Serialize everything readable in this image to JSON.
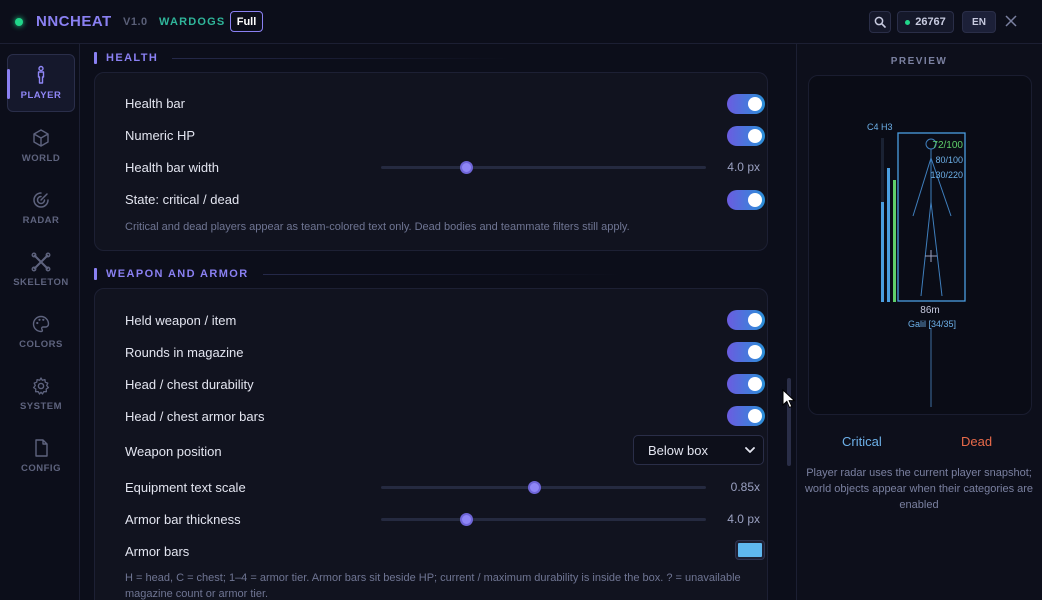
{
  "header": {
    "brand": "NNCHEAT",
    "version": "V1.0",
    "game": "WARDOGS",
    "tier": "Full",
    "online_count": "26767",
    "language": "EN"
  },
  "sidebar": {
    "items": [
      {
        "label": "PLAYER",
        "icon": "person-icon",
        "active": true
      },
      {
        "label": "WORLD",
        "icon": "cube-icon",
        "active": false
      },
      {
        "label": "RADAR",
        "icon": "radar-icon",
        "active": false
      },
      {
        "label": "SKELETON",
        "icon": "skeleton-icon",
        "active": false
      },
      {
        "label": "COLORS",
        "icon": "palette-icon",
        "active": false
      },
      {
        "label": "SYSTEM",
        "icon": "gear-icon",
        "active": false
      },
      {
        "label": "CONFIG",
        "icon": "file-icon",
        "active": false
      }
    ]
  },
  "health": {
    "title": "HEALTH",
    "health_bar": {
      "label": "Health bar",
      "on": true
    },
    "numeric_hp": {
      "label": "Numeric HP",
      "on": true
    },
    "bar_width": {
      "label": "Health bar width",
      "value": "4.0 px",
      "fraction": 0.26
    },
    "state": {
      "label": "State: critical / dead",
      "on": true
    },
    "hint": "Critical and dead players appear as team-colored text only. Dead bodies and teammate filters still apply."
  },
  "weapon": {
    "title": "WEAPON AND ARMOR",
    "held_weapon": {
      "label": "Held weapon / item",
      "on": true
    },
    "rounds": {
      "label": "Rounds in magazine",
      "on": true
    },
    "durability": {
      "label": "Head / chest durability",
      "on": true
    },
    "armor_bars_toggle": {
      "label": "Head / chest armor bars",
      "on": true
    },
    "position": {
      "label": "Weapon position",
      "value": "Below box"
    },
    "text_scale": {
      "label": "Equipment text scale",
      "value": "0.85x",
      "fraction": 0.47
    },
    "bar_thickness": {
      "label": "Armor bar thickness",
      "value": "4.0 px",
      "fraction": 0.26
    },
    "armor_bars": {
      "label": "Armor bars",
      "color": "#5fb8f0"
    },
    "hint": "H = head, C = chest; 1–4 = armor tier. Armor bars sit beside HP; current / maximum durability is inside the box. ? = unavailable magazine count or armor tier."
  },
  "preview": {
    "title": "PREVIEW",
    "armor_tag": "C4 H3",
    "hp": "72/100",
    "head_dur": "80/100",
    "chest_dur": "130/220",
    "distance": "86m",
    "weapon": "Galil [34/35]",
    "legend_critical": "Critical",
    "legend_dead": "Dead",
    "note": "Player radar uses the current player snapshot; world objects appear when their categories are enabled"
  }
}
